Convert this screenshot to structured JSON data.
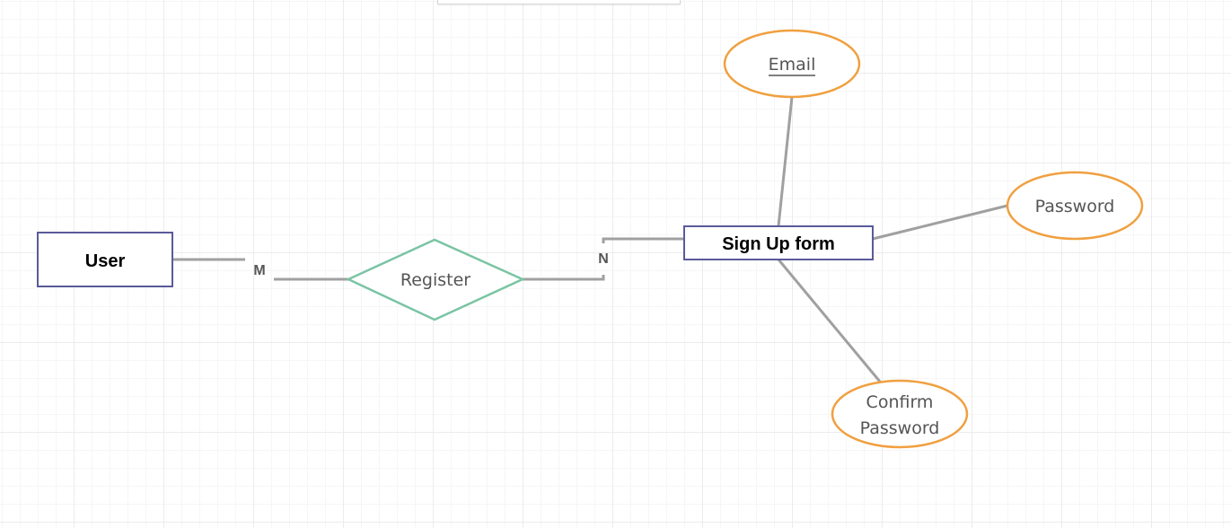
{
  "diagram": {
    "entities": {
      "user": "User",
      "signup_form": "Sign Up form"
    },
    "relationship": {
      "register": "Register"
    },
    "attributes": {
      "email": "Email",
      "password": "Password",
      "confirm_password_line1": "Confirm",
      "confirm_password_line2": "Password"
    },
    "cardinality": {
      "user_side": "M",
      "form_side": "N"
    }
  },
  "colors": {
    "entity_border": "#5a5a9a",
    "relationship_border": "#7ac4a4",
    "attribute_border": "#f0a040",
    "connector": "#a0a0a0"
  }
}
